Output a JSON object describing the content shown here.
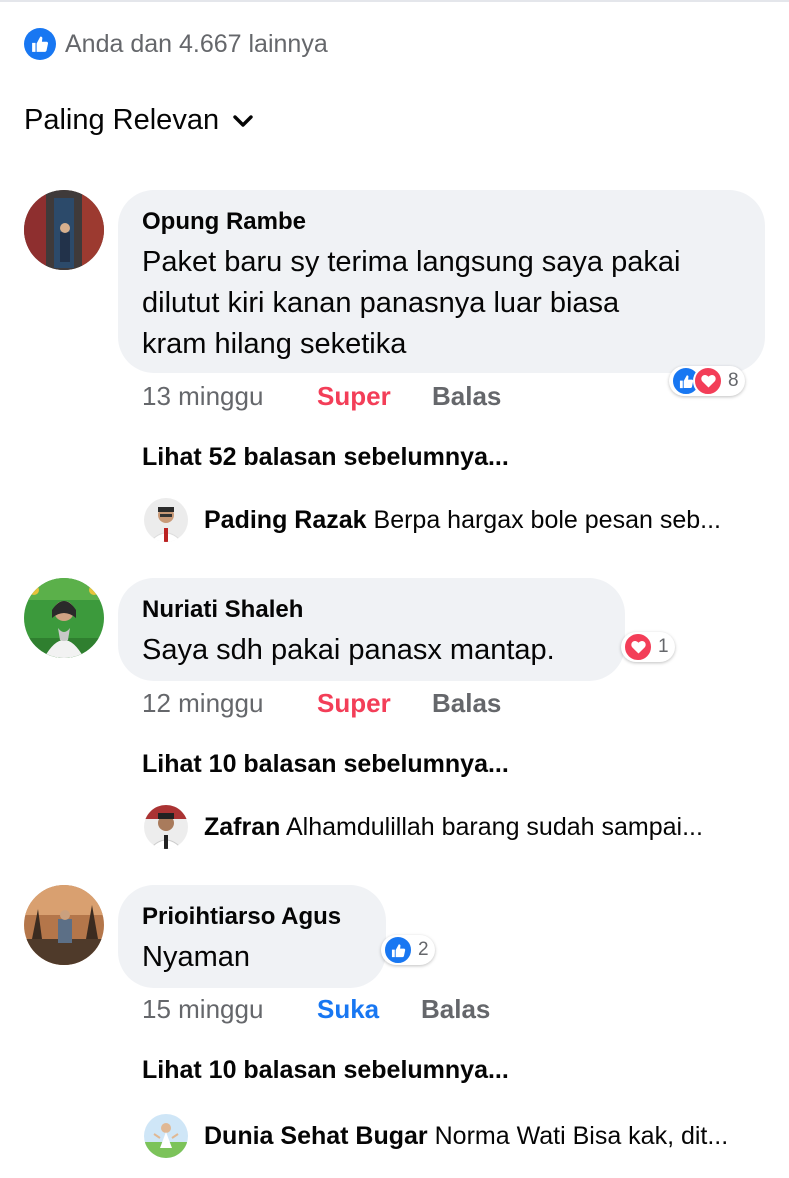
{
  "summary": {
    "text": "Anda dan 4.667 lainnya",
    "icon": "like-icon"
  },
  "sort": {
    "label": "Paling Relevan",
    "icon": "chevron-down-icon"
  },
  "comments": [
    {
      "name": "Opung Rambe",
      "lines": [
        "Paket baru sy terima langsung saya pakai",
        "dilutut kiri kanan panasnya luar biasa",
        "kram hilang seketika"
      ],
      "time": "13 minggu",
      "reaction_action": "Super",
      "reply_action": "Balas",
      "reaction_count": "8",
      "reaction_icons": [
        "like-icon",
        "love-icon"
      ],
      "view_more": "Lihat 52 balasan sebelumnya...",
      "latest_reply": {
        "name": "Pading Razak",
        "text": "Berpa hargax bole pesan seb..."
      }
    },
    {
      "name": "Nuriati Shaleh",
      "lines": [
        "Saya sdh pakai panasx mantap."
      ],
      "time": "12 minggu",
      "reaction_action": "Super",
      "reply_action": "Balas",
      "reaction_count": "1",
      "reaction_icons": [
        "love-icon"
      ],
      "view_more": "Lihat 10 balasan sebelumnya...",
      "latest_reply": {
        "name": "Zafran",
        "text": "Alhamdulillah barang sudah sampai..."
      }
    },
    {
      "name": "Prioihtiarso Agus",
      "lines": [
        "Nyaman"
      ],
      "time": "15 minggu",
      "reaction_action": "Suka",
      "reply_action": "Balas",
      "reaction_count": "2",
      "reaction_icons": [
        "like-icon"
      ],
      "view_more": "Lihat 10 balasan sebelumnya...",
      "latest_reply": {
        "name": "Dunia Sehat Bugar",
        "text": "Norma Wati Bisa kak, dit..."
      }
    }
  ],
  "colors": {
    "like": "#1877f2",
    "love": "#f33e58",
    "bubble": "#f0f2f5",
    "meta": "#65676b"
  }
}
